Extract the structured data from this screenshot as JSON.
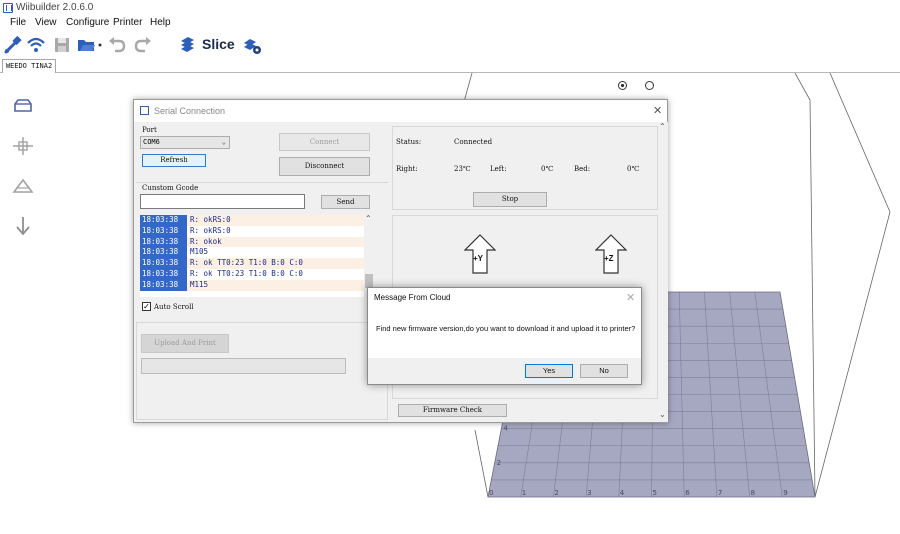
{
  "app": {
    "title": "Wiibuilder 2.0.6.0"
  },
  "menu": [
    "File",
    "View",
    "Configure",
    "Printer",
    "Help"
  ],
  "toolbar": {
    "slice_label": "Slice"
  },
  "tabs": [
    {
      "label": "WEEDO TINA2"
    }
  ],
  "scene": {
    "x_ticks": [
      "0",
      "1",
      "2",
      "3",
      "4",
      "5",
      "6",
      "7",
      "8",
      "9"
    ],
    "y_ticks": [
      "2",
      "4"
    ]
  },
  "serial_window": {
    "title": "Serial Connection",
    "port_label": "Port",
    "port_value": "COM6",
    "connect_label": "Connect",
    "refresh_label": "Refresh",
    "disconnect_label": "Disconnect",
    "custom_gcode_label": "Cunstom Gcode",
    "gcode_input": "",
    "send_label": "Send",
    "log": [
      {
        "time": "18:03:38",
        "msg": "R: okRS:0"
      },
      {
        "time": "18:03:38",
        "msg": "R: okRS:0"
      },
      {
        "time": "18:03:38",
        "msg": "R: okok"
      },
      {
        "time": "18:03:38",
        "msg": "M105"
      },
      {
        "time": "18:03:38",
        "msg": "R: ok TT0:23 T1:0 B:0 C:0"
      },
      {
        "time": "18:03:38",
        "msg": "R: ok TT0:23 T1:0 B:0 C:0"
      },
      {
        "time": "18:03:38",
        "msg": "M115"
      }
    ],
    "auto_scroll_label": "Auto Scroll",
    "auto_scroll_checked": true,
    "upload_label": "Upload And Print",
    "status_label": "Status:",
    "status_value": "Connected",
    "right_label": "Right:",
    "right_value": "23℃",
    "left_label": "Left:",
    "left_value": "0℃",
    "bed_label": "Bed:",
    "bed_value": "0℃",
    "stop_label": "Stop",
    "jog_y_label": "+Y",
    "jog_z_label": "+Z",
    "firmware_label": "Firmware Check"
  },
  "message_box": {
    "title": "Message From Cloud",
    "text": "Find new firmware version,do you want to download it and upload it to printer?",
    "yes_label": "Yes",
    "no_label": "No"
  },
  "colors": {
    "accent": "#2d5fb8",
    "log_time_bg": "#3468c8",
    "log_text": "#1a2d8a",
    "bed_fill": "#a6a7c0",
    "bed_grid": "#7d7e96"
  }
}
